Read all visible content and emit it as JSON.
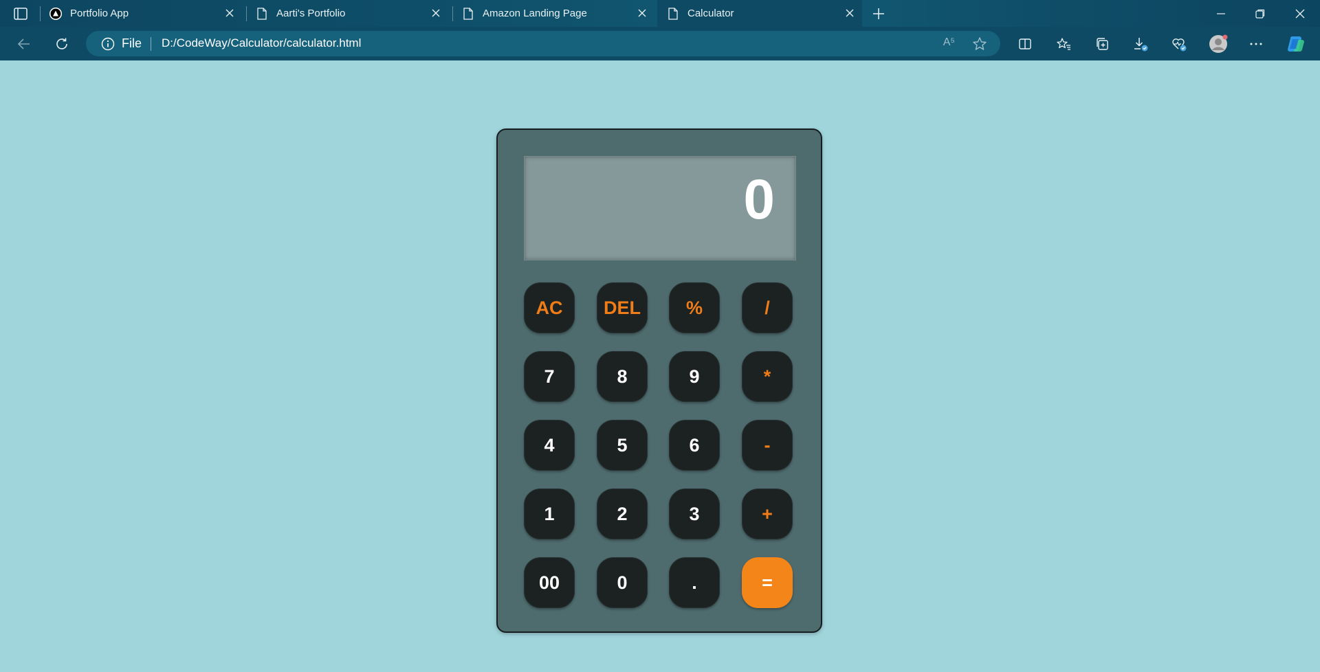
{
  "browser": {
    "tabs": [
      {
        "title": "Portfolio App",
        "icon": "app-logo-icon"
      },
      {
        "title": "Aarti's Portfolio",
        "icon": "page-icon"
      },
      {
        "title": "Amazon Landing Page",
        "icon": "page-icon"
      },
      {
        "title": "Calculator",
        "icon": "page-icon",
        "active": true
      }
    ],
    "address": {
      "scheme_label": "File",
      "url": "D:/CodeWay/Calculator/calculator.html",
      "read_aloud": "A⁵"
    }
  },
  "calculator": {
    "display": "0",
    "keys": [
      {
        "label": "AC",
        "kind": "op"
      },
      {
        "label": "DEL",
        "kind": "op"
      },
      {
        "label": "%",
        "kind": "op"
      },
      {
        "label": "/",
        "kind": "op"
      },
      {
        "label": "7",
        "kind": "num"
      },
      {
        "label": "8",
        "kind": "num"
      },
      {
        "label": "9",
        "kind": "num"
      },
      {
        "label": "*",
        "kind": "op"
      },
      {
        "label": "4",
        "kind": "num"
      },
      {
        "label": "5",
        "kind": "num"
      },
      {
        "label": "6",
        "kind": "num"
      },
      {
        "label": "-",
        "kind": "op"
      },
      {
        "label": "1",
        "kind": "num"
      },
      {
        "label": "2",
        "kind": "num"
      },
      {
        "label": "3",
        "kind": "num"
      },
      {
        "label": "+",
        "kind": "op"
      },
      {
        "label": "00",
        "kind": "num"
      },
      {
        "label": "0",
        "kind": "num"
      },
      {
        "label": ".",
        "kind": "num"
      },
      {
        "label": "=",
        "kind": "equals"
      }
    ]
  },
  "colors": {
    "page_background": "#a0d5dc",
    "calculator_body": "#4e6b6e",
    "display_background": "#85989a",
    "key_background": "#1c2222",
    "operator_text": "#f07d18",
    "equals_background": "#f38519"
  }
}
